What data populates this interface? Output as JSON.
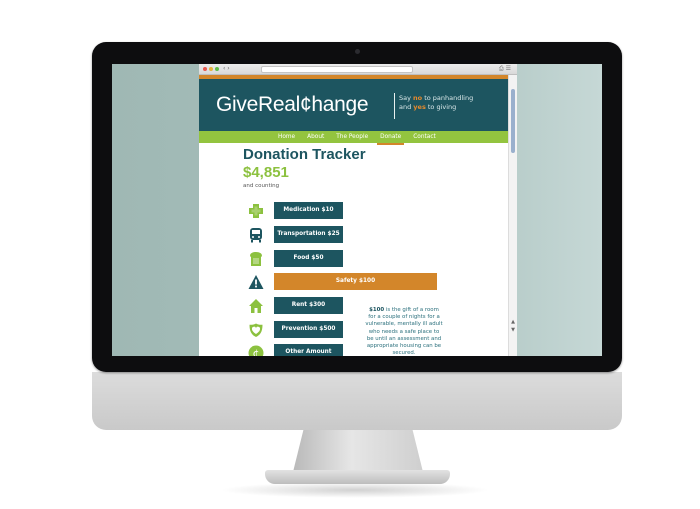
{
  "site": {
    "logo": "GiveReal¢hange",
    "tagline": {
      "part1": "Say ",
      "highlight1": "no",
      "part2": " to panhandling",
      "part3": "and ",
      "highlight2": "yes",
      "part4": " to giving"
    },
    "nav": [
      "Home",
      "About",
      "The People",
      "Donate",
      "Contact"
    ],
    "active_nav": "Donate"
  },
  "tracker": {
    "title": "Donation Tracker",
    "amount": "$4,851",
    "subtitle": "and counting"
  },
  "options": [
    {
      "label": "Medication $10",
      "icon": "medical-cross-icon"
    },
    {
      "label": "Transportation $25",
      "icon": "bus-icon"
    },
    {
      "label": "Food $50",
      "icon": "bread-icon"
    },
    {
      "label": "Safety $100",
      "icon": "warning-icon",
      "selected": true
    },
    {
      "label": "Rent $300",
      "icon": "house-icon"
    },
    {
      "label": "Prevention $500",
      "icon": "heart-icon"
    },
    {
      "label": "Other Amount",
      "icon": "cent-icon"
    }
  ],
  "description": {
    "amount": "$100",
    "text": " is the gift of a room for a couple of nights for a vulnerable, mentally ill adult who needs a safe place to be until an assessment and appropriate housing can be secured."
  },
  "colors": {
    "teal": "#1d5560",
    "green": "#93c43f",
    "orange": "#d3862a"
  }
}
